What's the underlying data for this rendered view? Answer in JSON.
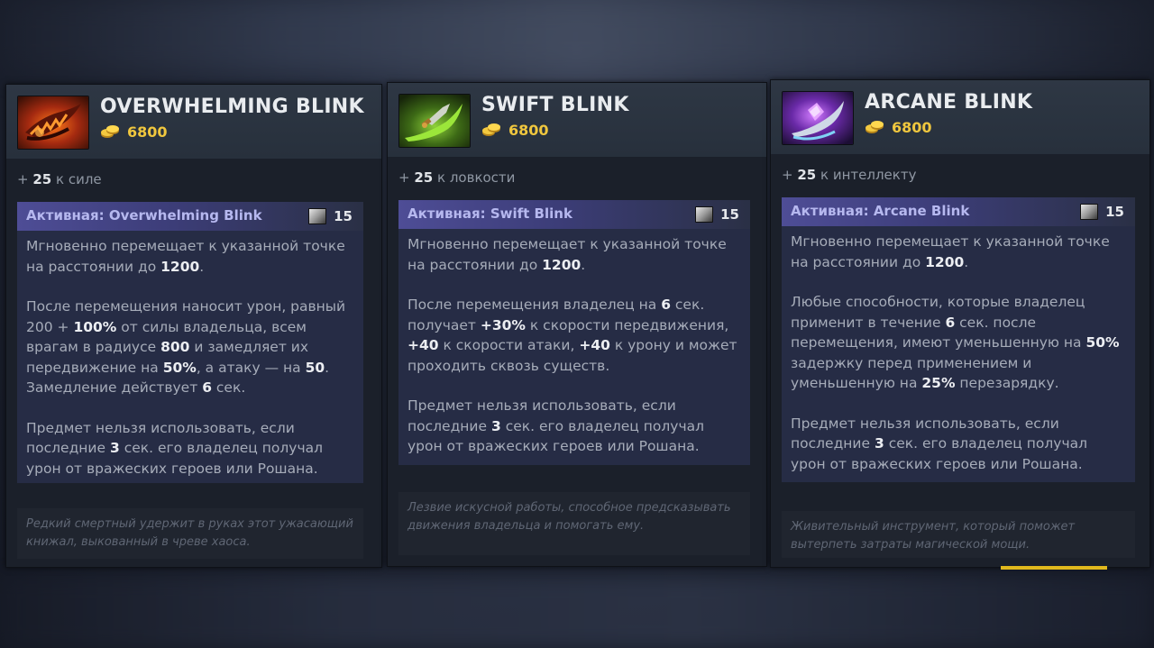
{
  "cards": [
    {
      "title": "OVERWHELMING BLINK",
      "cost": "6800",
      "stat_prefix": "+",
      "stat_value": "25",
      "stat_text": "к силе",
      "active_label": "Активная: Overwhelming Blink",
      "cooldown": "15",
      "desc_p1": [
        "Мгновенно перемещает к указанной точке на расстоянии до ",
        "1200",
        "."
      ],
      "desc_p2": [
        "После перемещения наносит урон, равный 200 + ",
        "100%",
        " от силы владельца, всем врагам в радиусе ",
        "800",
        " и замедляет их передвижение на ",
        "50%",
        ", а атаку — на ",
        "50",
        ". Замедление действует ",
        "6",
        " сек."
      ],
      "desc_p3": [
        "Предмет нельзя использовать, если последние ",
        "3",
        " сек. его владелец получал урон от вражеских героев или Рошана."
      ],
      "lore": "Редкий смертный удержит в руках этот ужасающий книжал, выкованный в чреве хаоса.",
      "icon": "overwhelming-blink-dagger-icon"
    },
    {
      "title": "SWIFT BLINK",
      "cost": "6800",
      "stat_prefix": "+",
      "stat_value": "25",
      "stat_text": "к ловкости",
      "active_label": "Активная: Swift Blink",
      "cooldown": "15",
      "desc_p1": [
        "Мгновенно перемещает к указанной точке на расстоянии до ",
        "1200",
        "."
      ],
      "desc_p2": [
        "После перемещения владелец на ",
        "6",
        " сек. получает ",
        "+30%",
        " к скорости передвижения, ",
        "+40",
        " к скорости атаки, ",
        "+40",
        " к урону и может проходить сквозь существ."
      ],
      "desc_p3": [
        "Предмет нельзя использовать, если последние ",
        "3",
        " сек. его владелец получал урон от вражеских героев или Рошана."
      ],
      "lore": "Лезвие искусной работы, способное предсказывать движения владельца и помогать ему.",
      "icon": "swift-blink-dagger-icon"
    },
    {
      "title": "ARCANE BLINK",
      "cost": "6800",
      "stat_prefix": "+",
      "stat_value": "25",
      "stat_text": "к интеллекту",
      "active_label": "Активная: Arcane Blink",
      "cooldown": "15",
      "desc_p1": [
        "Мгновенно перемещает к указанной точке на расстоянии до ",
        "1200",
        "."
      ],
      "desc_p2": [
        "Любые способности, которые владелец применит в течение ",
        "6",
        " сек. после перемещения, имеют уменьшенную на ",
        "50%",
        " задержку перед применением и уменьшенную на ",
        "25%",
        " перезарядку."
      ],
      "desc_p3": [
        "Предмет нельзя использовать, если последние ",
        "3",
        " сек. его владелец получал урон от вражеских героев или Рошана."
      ],
      "lore": "Живительный инструмент, который поможет вытерпеть затраты магической мощи.",
      "icon": "arcane-blink-dagger-icon"
    }
  ],
  "icons": {
    "gold": "gold-coins-icon",
    "cooldown": "cooldown-icon"
  },
  "colors": {
    "gold": "#f0c73e",
    "active_bar": "#4e4d96",
    "active_title": "#b6b8ef"
  }
}
